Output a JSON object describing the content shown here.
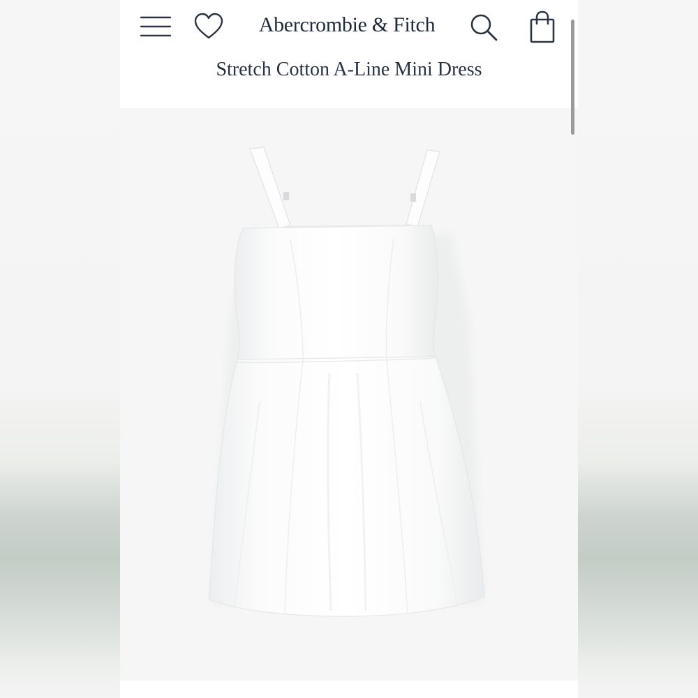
{
  "header": {
    "brand": "Abercrombie & Fitch",
    "icons": {
      "menu": "hamburger-menu-icon",
      "wishlist": "heart-icon",
      "search": "search-icon",
      "bag": "shopping-bag-icon"
    }
  },
  "product": {
    "title": "Stretch Cotton A-Line Mini Dress",
    "image_subject": "white-a-line-mini-dress"
  },
  "colors": {
    "brand_navy": "#1f2a3a",
    "image_background": "#f6f6f6",
    "dress": "#ffffff"
  }
}
